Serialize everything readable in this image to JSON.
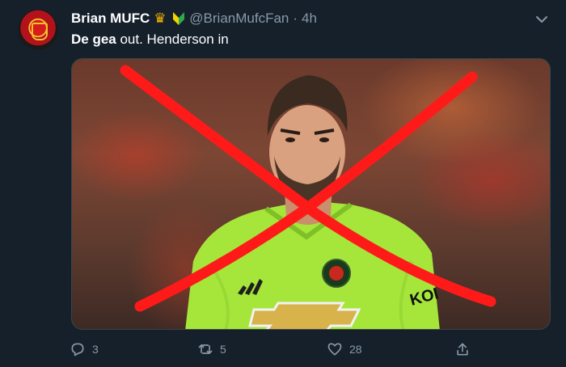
{
  "tweet": {
    "display_name": "Brian MUFC",
    "handle": "@BrianMufcFan",
    "separator": "·",
    "time": "4h",
    "text_bold": "De gea",
    "text_rest": " out. Henderson in",
    "media_overlay_text": "KOI",
    "stats": {
      "replies": "3",
      "retweets": "5",
      "likes": "28"
    }
  },
  "icons": {
    "badge_1": "crown-icon",
    "badge_2": "beginner-leaf-icon",
    "menu": "chevron-down-icon",
    "reply": "reply-icon",
    "retweet": "retweet-icon",
    "like": "heart-icon",
    "share": "share-icon"
  },
  "colors": {
    "background": "#15202b",
    "secondary_text": "#8899a6",
    "cross_red": "#ff1a1a",
    "jersey_green": "#a6e63a"
  }
}
